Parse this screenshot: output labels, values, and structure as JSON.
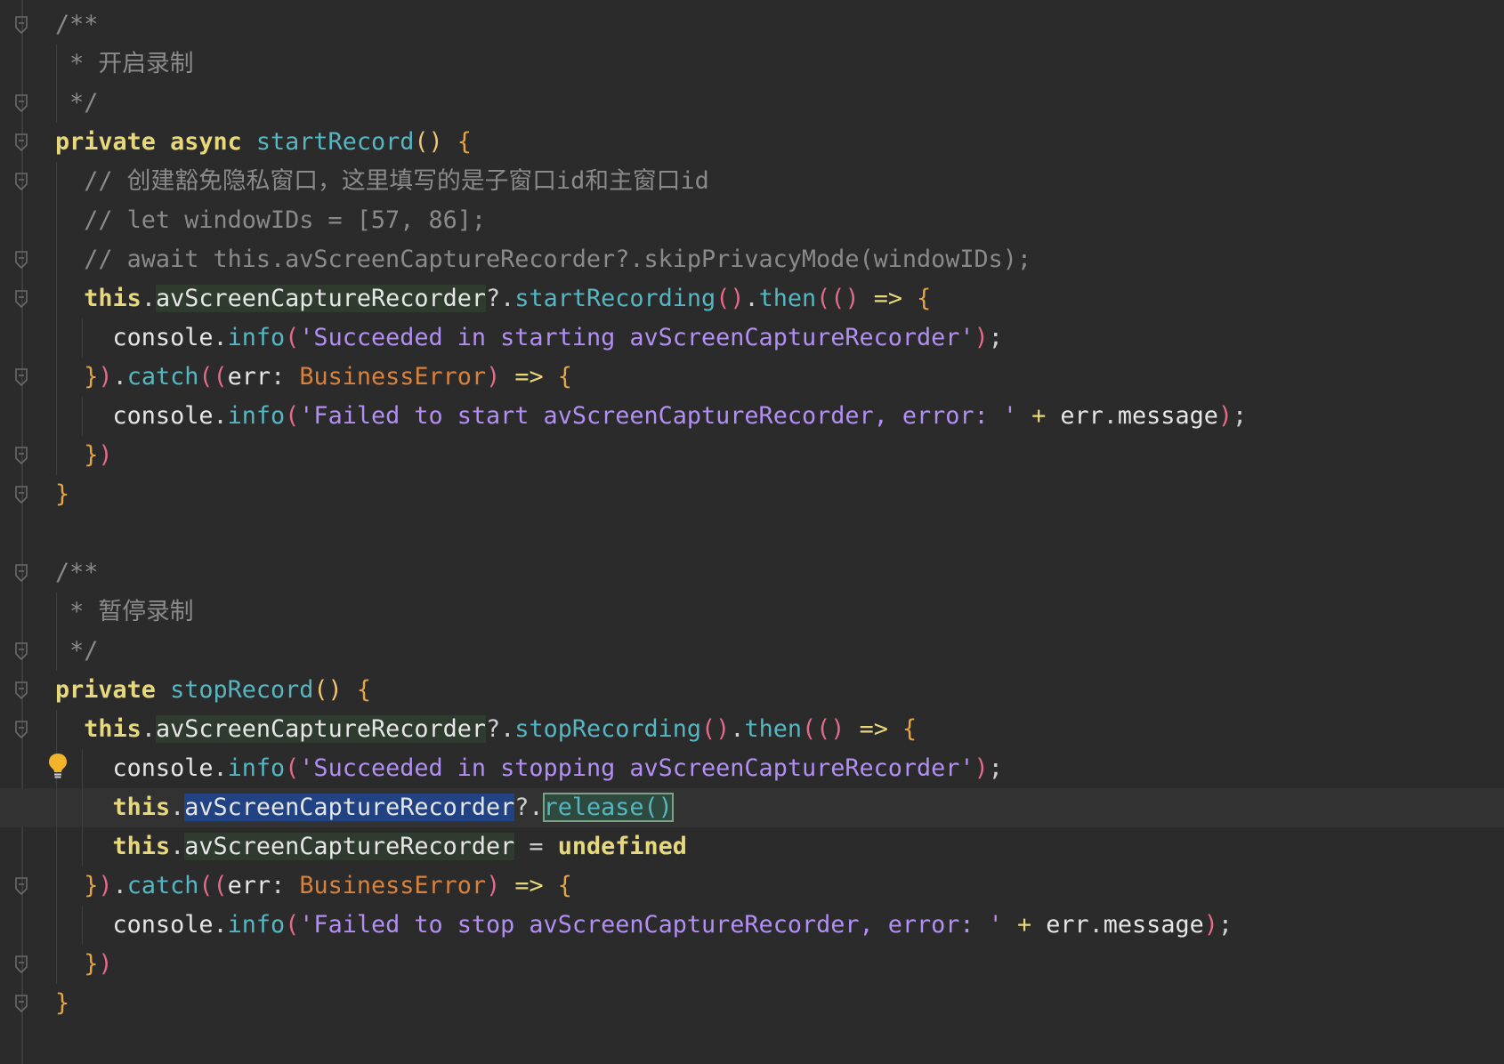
{
  "editor": {
    "language": "ArkTS",
    "lines": [
      {
        "tokens": [
          {
            "t": "/**",
            "c": "comment"
          }
        ]
      },
      {
        "tokens": [
          {
            "t": " * 开启录制",
            "c": "comment"
          }
        ]
      },
      {
        "tokens": [
          {
            "t": " */",
            "c": "comment"
          }
        ]
      },
      {
        "tokens": [
          {
            "t": "private",
            "c": "kw"
          },
          {
            "t": " ",
            "c": "plain"
          },
          {
            "t": "async",
            "c": "kw"
          },
          {
            "t": " ",
            "c": "plain"
          },
          {
            "t": "startRecord",
            "c": "fn"
          },
          {
            "t": "()",
            "c": "paren2"
          },
          {
            "t": " ",
            "c": "plain"
          },
          {
            "t": "{",
            "c": "brace"
          }
        ]
      },
      {
        "tokens": [
          {
            "t": "  // 创建豁免隐私窗口，这里填写的是子窗口id和主窗口id",
            "c": "comment"
          }
        ]
      },
      {
        "tokens": [
          {
            "t": "  // let windowIDs = [57, 86];",
            "c": "comment"
          }
        ]
      },
      {
        "tokens": [
          {
            "t": "  // await this.avScreenCaptureRecorder?.skipPrivacyMode(windowIDs);",
            "c": "comment"
          }
        ]
      },
      {
        "tokens": [
          {
            "t": "  ",
            "c": "plain"
          },
          {
            "t": "this",
            "c": "kw"
          },
          {
            "t": ".",
            "c": "punc"
          },
          {
            "t": "avScreenCaptureRecorder",
            "c": "field"
          },
          {
            "t": "?.",
            "c": "punc"
          },
          {
            "t": "startRecording",
            "c": "fn"
          },
          {
            "t": "()",
            "c": "paren1"
          },
          {
            "t": ".",
            "c": "punc"
          },
          {
            "t": "then",
            "c": "fn"
          },
          {
            "t": "((",
            "c": "paren1"
          },
          {
            "t": ")",
            "c": "paren1"
          },
          {
            "t": " => ",
            "c": "op"
          },
          {
            "t": "{",
            "c": "brace"
          }
        ]
      },
      {
        "tokens": [
          {
            "t": "    console",
            "c": "plain"
          },
          {
            "t": ".",
            "c": "punc"
          },
          {
            "t": "info",
            "c": "fn"
          },
          {
            "t": "(",
            "c": "paren1"
          },
          {
            "t": "'Succeeded in starting avScreenCaptureRecorder'",
            "c": "str"
          },
          {
            "t": ")",
            "c": "paren1"
          },
          {
            "t": ";",
            "c": "punc"
          }
        ]
      },
      {
        "tokens": [
          {
            "t": "  ",
            "c": "plain"
          },
          {
            "t": "}",
            "c": "brace"
          },
          {
            "t": ")",
            "c": "paren1"
          },
          {
            "t": ".",
            "c": "punc"
          },
          {
            "t": "catch",
            "c": "fn"
          },
          {
            "t": "((",
            "c": "paren1"
          },
          {
            "t": "err",
            "c": "plain"
          },
          {
            "t": ": ",
            "c": "punc"
          },
          {
            "t": "BusinessError",
            "c": "type"
          },
          {
            "t": ")",
            "c": "paren1"
          },
          {
            "t": " => ",
            "c": "op"
          },
          {
            "t": "{",
            "c": "brace"
          }
        ]
      },
      {
        "tokens": [
          {
            "t": "    console",
            "c": "plain"
          },
          {
            "t": ".",
            "c": "punc"
          },
          {
            "t": "info",
            "c": "fn"
          },
          {
            "t": "(",
            "c": "paren1"
          },
          {
            "t": "'Failed to start avScreenCaptureRecorder, error: '",
            "c": "str"
          },
          {
            "t": " + ",
            "c": "op"
          },
          {
            "t": "err",
            "c": "plain"
          },
          {
            "t": ".",
            "c": "punc"
          },
          {
            "t": "message",
            "c": "plain"
          },
          {
            "t": ")",
            "c": "paren1"
          },
          {
            "t": ";",
            "c": "punc"
          }
        ]
      },
      {
        "tokens": [
          {
            "t": "  ",
            "c": "plain"
          },
          {
            "t": "}",
            "c": "brace"
          },
          {
            "t": ")",
            "c": "paren1"
          }
        ]
      },
      {
        "tokens": [
          {
            "t": "}",
            "c": "brace"
          }
        ]
      },
      {
        "tokens": [
          {
            "t": "",
            "c": "plain"
          }
        ]
      },
      {
        "tokens": [
          {
            "t": "/**",
            "c": "comment"
          }
        ]
      },
      {
        "tokens": [
          {
            "t": " * 暂停录制",
            "c": "comment"
          }
        ]
      },
      {
        "tokens": [
          {
            "t": " */",
            "c": "comment"
          }
        ]
      },
      {
        "tokens": [
          {
            "t": "private",
            "c": "kw"
          },
          {
            "t": " ",
            "c": "plain"
          },
          {
            "t": "stopRecord",
            "c": "fn"
          },
          {
            "t": "()",
            "c": "paren2"
          },
          {
            "t": " ",
            "c": "plain"
          },
          {
            "t": "{",
            "c": "brace"
          }
        ]
      },
      {
        "tokens": [
          {
            "t": "  ",
            "c": "plain"
          },
          {
            "t": "this",
            "c": "kw"
          },
          {
            "t": ".",
            "c": "punc"
          },
          {
            "t": "avScreenCaptureRecorder",
            "c": "field"
          },
          {
            "t": "?.",
            "c": "punc"
          },
          {
            "t": "stopRecording",
            "c": "fn"
          },
          {
            "t": "()",
            "c": "paren1"
          },
          {
            "t": ".",
            "c": "punc"
          },
          {
            "t": "then",
            "c": "fn"
          },
          {
            "t": "((",
            "c": "paren1"
          },
          {
            "t": ")",
            "c": "paren1"
          },
          {
            "t": " => ",
            "c": "op"
          },
          {
            "t": "{",
            "c": "brace"
          }
        ]
      },
      {
        "tokens": [
          {
            "t": "    console",
            "c": "plain"
          },
          {
            "t": ".",
            "c": "punc"
          },
          {
            "t": "info",
            "c": "fn"
          },
          {
            "t": "(",
            "c": "paren1"
          },
          {
            "t": "'Succeeded in stopping avScreenCaptureRecorder'",
            "c": "str"
          },
          {
            "t": ")",
            "c": "paren1"
          },
          {
            "t": ";",
            "c": "punc"
          }
        ]
      },
      {
        "current": true,
        "tokens": [
          {
            "t": "    ",
            "c": "plain"
          },
          {
            "t": "this",
            "c": "kw"
          },
          {
            "t": ".",
            "c": "punc"
          },
          {
            "t": "avScreenCaptureRecorder",
            "c": "field-sel"
          },
          {
            "t": "?.",
            "c": "punc"
          },
          {
            "t": "release()",
            "c": "field-box"
          }
        ]
      },
      {
        "tokens": [
          {
            "t": "    ",
            "c": "plain"
          },
          {
            "t": "this",
            "c": "kw"
          },
          {
            "t": ".",
            "c": "punc"
          },
          {
            "t": "avScreenCaptureRecorder",
            "c": "field"
          },
          {
            "t": " = ",
            "c": "punc"
          },
          {
            "t": "undefined",
            "c": "kw"
          }
        ]
      },
      {
        "tokens": [
          {
            "t": "  ",
            "c": "plain"
          },
          {
            "t": "}",
            "c": "brace"
          },
          {
            "t": ")",
            "c": "paren1"
          },
          {
            "t": ".",
            "c": "punc"
          },
          {
            "t": "catch",
            "c": "fn"
          },
          {
            "t": "((",
            "c": "paren1"
          },
          {
            "t": "err",
            "c": "plain"
          },
          {
            "t": ": ",
            "c": "punc"
          },
          {
            "t": "BusinessError",
            "c": "type"
          },
          {
            "t": ")",
            "c": "paren1"
          },
          {
            "t": " => ",
            "c": "op"
          },
          {
            "t": "{",
            "c": "brace"
          }
        ]
      },
      {
        "tokens": [
          {
            "t": "    console",
            "c": "plain"
          },
          {
            "t": ".",
            "c": "punc"
          },
          {
            "t": "info",
            "c": "fn"
          },
          {
            "t": "(",
            "c": "paren1"
          },
          {
            "t": "'Failed to stop avScreenCaptureRecorder, error: '",
            "c": "str"
          },
          {
            "t": " + ",
            "c": "op"
          },
          {
            "t": "err",
            "c": "plain"
          },
          {
            "t": ".",
            "c": "punc"
          },
          {
            "t": "message",
            "c": "plain"
          },
          {
            "t": ")",
            "c": "paren1"
          },
          {
            "t": ";",
            "c": "punc"
          }
        ]
      },
      {
        "tokens": [
          {
            "t": "  ",
            "c": "plain"
          },
          {
            "t": "}",
            "c": "brace"
          },
          {
            "t": ")",
            "c": "paren1"
          }
        ]
      },
      {
        "tokens": [
          {
            "t": "}",
            "c": "brace"
          }
        ]
      }
    ],
    "fold_markers": [
      0,
      2,
      3,
      4,
      6,
      7,
      9,
      11,
      12,
      14,
      16,
      17,
      18,
      22,
      24,
      25
    ],
    "intention_icon": "lightbulb-icon"
  }
}
